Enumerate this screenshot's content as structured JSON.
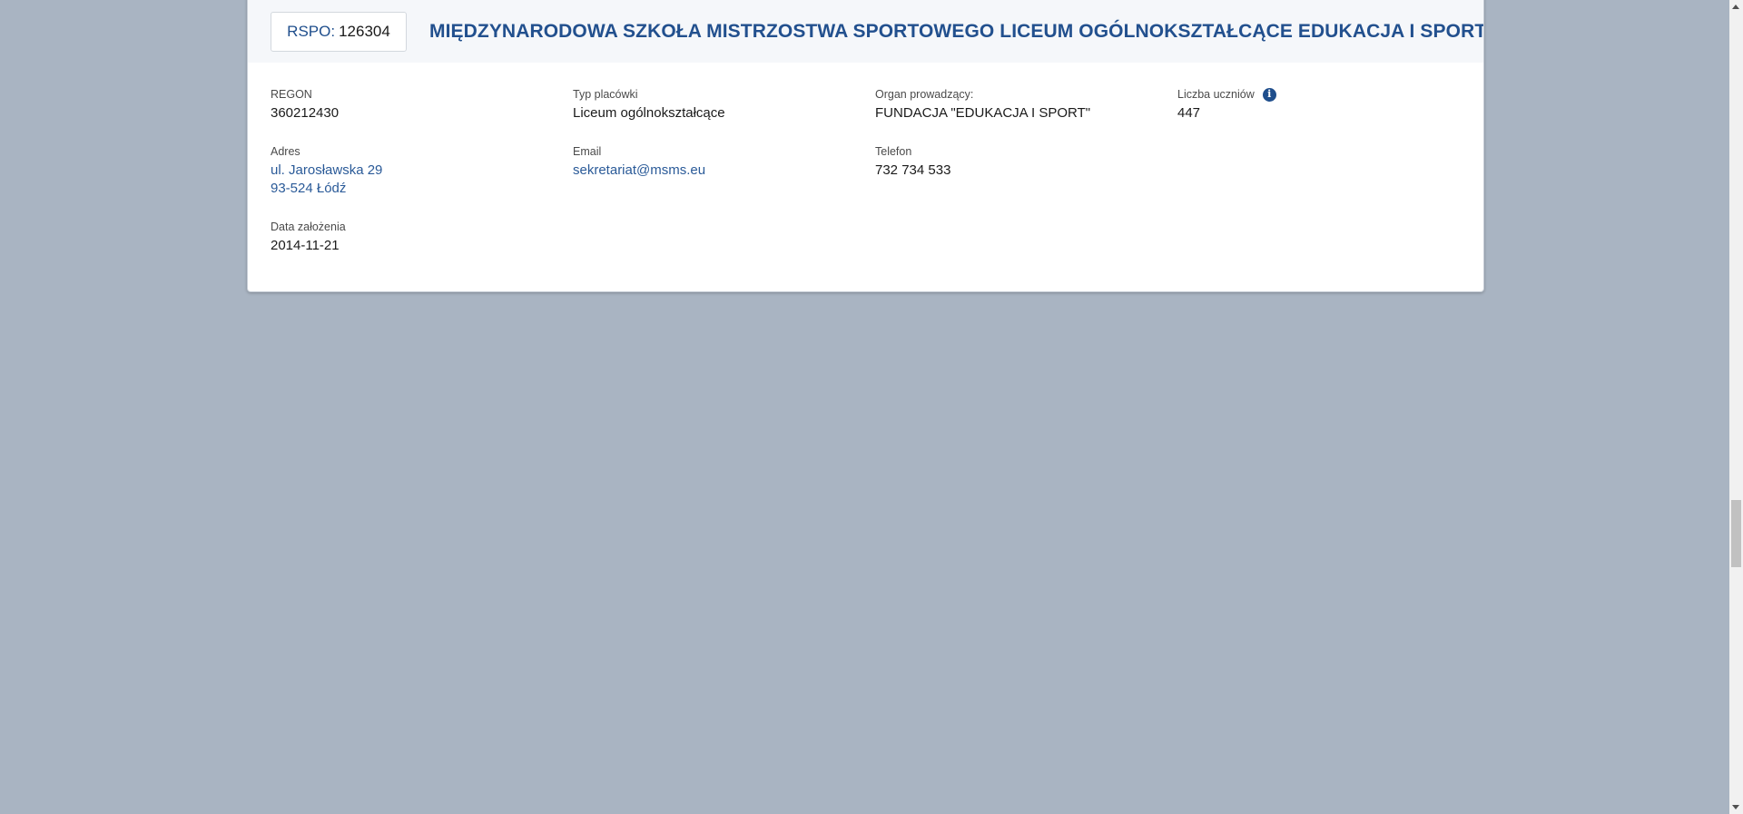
{
  "header": {
    "rspo_label": "RSPO:",
    "rspo_value": "126304",
    "school_name": "MIĘDZYNARODOWA SZKOŁA MISTRZOSTWA SPORTOWEGO LICEUM OGÓLNOKSZTAŁCĄCE EDUKACJA I SPORT"
  },
  "fields": {
    "regon": {
      "label": "REGON",
      "value": "360212430"
    },
    "typ_placowki": {
      "label": "Typ placówki",
      "value": "Liceum ogólnokształcące"
    },
    "organ": {
      "label": "Organ prowadzący:",
      "value": "FUNDACJA \"EDUKACJA I SPORT\""
    },
    "liczba_uczniow": {
      "label": "Liczba uczniów",
      "value": "447",
      "icon": "info-icon"
    },
    "adres": {
      "label": "Adres",
      "line1": "ul. Jarosławska 29",
      "line2": "93-524 Łódź"
    },
    "email": {
      "label": "Email",
      "value": "sekretariat@msms.eu"
    },
    "telefon": {
      "label": "Telefon",
      "value": "732 734 533"
    },
    "data_zalozenia": {
      "label": "Data założenia",
      "value": "2014-11-21"
    }
  },
  "colors": {
    "background": "#a9b4c2",
    "accent": "#22508e",
    "link": "#2a5a98"
  }
}
